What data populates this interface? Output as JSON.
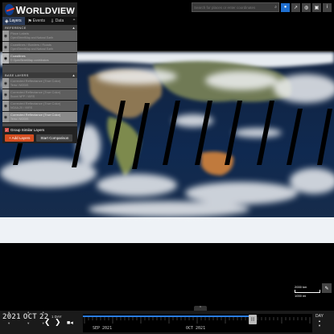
{
  "app": {
    "name_prefix": "W",
    "name_rest": "ORLDVIEW",
    "agency": "NASA"
  },
  "tabs": [
    {
      "label": "Layers",
      "icon": "layers-icon"
    },
    {
      "label": "Events",
      "icon": "flag-icon"
    },
    {
      "label": "Data",
      "icon": "download-icon"
    }
  ],
  "reference": {
    "header": "REFERENCE",
    "layers": [
      {
        "title": "Place Labels",
        "subtitle": "OpenStreetMap and Natural Earth",
        "visible": false
      },
      {
        "title": "Coastlines / Borders / Roads",
        "subtitle": "OpenStreetMap and Natural Earth",
        "visible": false
      },
      {
        "title": "Coastlines",
        "subtitle": "© OpenStreetMap contributors",
        "visible": true
      }
    ]
  },
  "base": {
    "header": "BASE LAYERS",
    "layers": [
      {
        "title": "Corrected Reflectance (True Color)",
        "subtitle": "Terra / MODIS",
        "visible": false
      },
      {
        "title": "Corrected Reflectance (True Color)",
        "subtitle": "Suomi NPP / VIIRS",
        "visible": false
      },
      {
        "title": "Corrected Reflectance (True Color)",
        "subtitle": "NOAA-20 / VIIRS",
        "visible": false
      },
      {
        "title": "Corrected Reflectance (True Color)",
        "subtitle": "Terra / MODIS",
        "visible": true
      }
    ]
  },
  "group_similar": "Group Similar Layers",
  "buttons": {
    "add_layers": "+ Add Layers",
    "start_comparison": "Start Comparison"
  },
  "search": {
    "placeholder": "Search for places or enter coordinates"
  },
  "scale": {
    "top": "2000 km",
    "bottom": "1000 mi"
  },
  "timeline": {
    "year": "2021",
    "month": "OCT",
    "day": "22",
    "step": "1 DAY",
    "zoom_label": "DAY",
    "months": [
      "SEP 2021",
      "OCT 2021"
    ]
  },
  "colors": {
    "accent": "#1f6fd0",
    "add_button": "#d54e21",
    "timeline_blue": "#2a7de1"
  }
}
